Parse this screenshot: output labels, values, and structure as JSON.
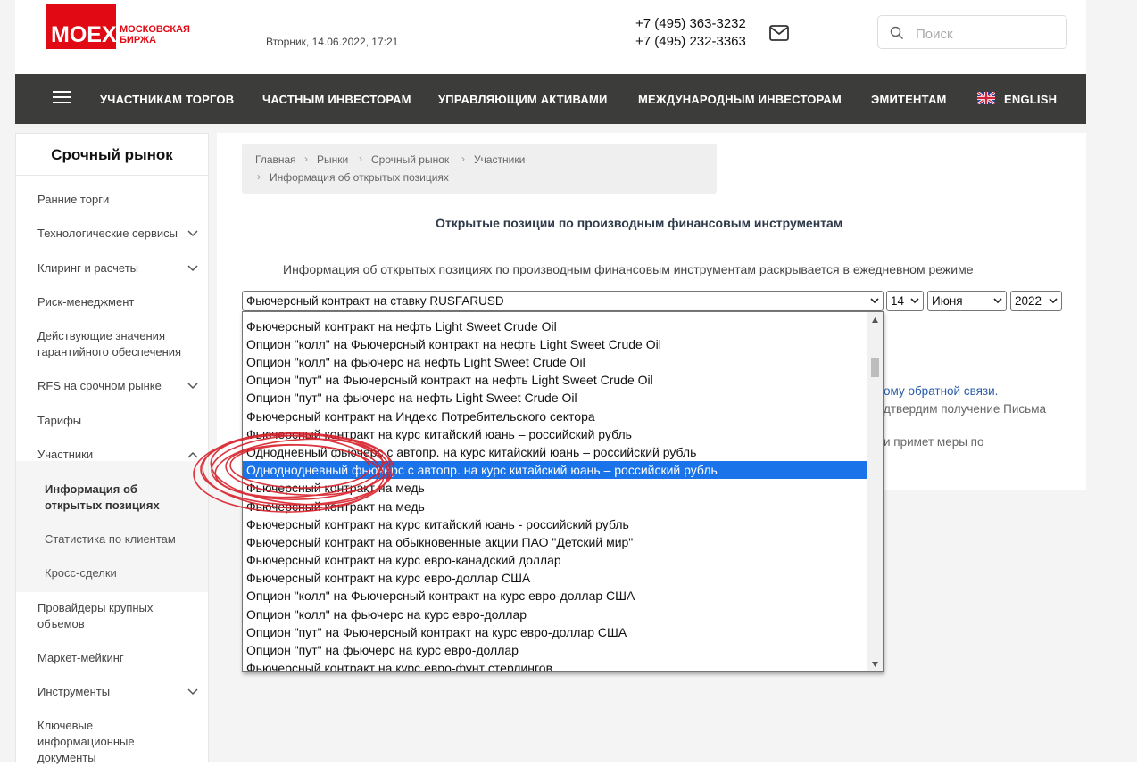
{
  "header": {
    "logo_main": "MOEX",
    "logo_sub_line1": "МОСКОВСКАЯ",
    "logo_sub_line2": "БИРЖА",
    "datetime": "Вторник, 14.06.2022, 17:21",
    "phone1": "+7 (495) 363-3232",
    "phone2": "+7 (495) 232-3363",
    "search_placeholder": "Поиск"
  },
  "nav": {
    "items": [
      "УЧАСТНИКАМ ТОРГОВ",
      "ЧАСТНЫМ ИНВЕСТОРАМ",
      "УПРАВЛЯЮЩИМ АКТИВАМИ",
      "МЕЖДУНАРОДНЫМ ИНВЕСТОРАМ",
      "ЭМИТЕНТАМ",
      "ENGLISH"
    ]
  },
  "sidebar": {
    "title": "Срочный рынок",
    "items": [
      {
        "label": "Ранние торги"
      },
      {
        "label": "Технологические сервисы"
      },
      {
        "label": "Клиринг и расчеты"
      },
      {
        "label": "Риск-менеджмент"
      },
      {
        "label_line1": "Действующие значения",
        "label_line2": "гарантийного обеспечения"
      },
      {
        "label": "RFS на срочном рынке"
      },
      {
        "label": "Тарифы"
      },
      {
        "label": "Участники"
      },
      {
        "label_line1": "Провайдеры крупных",
        "label_line2": "объемов"
      },
      {
        "label": "Маркет-мейкинг"
      },
      {
        "label": "Инструменты"
      },
      {
        "label_line1": "Ключевые",
        "label_line2": "информационные",
        "label_line3": "документы"
      }
    ],
    "subitems": [
      {
        "label_line1": "Информация об",
        "label_line2": "открытых позициях"
      },
      {
        "label": "Статистика по клиентам"
      },
      {
        "label": "Кросс-сделки"
      }
    ]
  },
  "breadcrumb": [
    "Главная",
    "Рынки",
    "Срочный рынок",
    "Участники",
    "Информация об открытых позициях"
  ],
  "page": {
    "title": "Открытые позиции по производным финансовым инструментам",
    "info": "Информация об открытых позициях по производным финансовым инструментам раскрывается в ежедневном режиме",
    "frag1": "ому обратной связи.",
    "frag2": "дтвердим получение Письма",
    "frag3": "и примет меры по"
  },
  "selects": {
    "instrument": "Фьючерсный контракт на ставку RUSFARUSD",
    "day": "14",
    "month": "Июня",
    "year": "2022"
  },
  "dropdown": {
    "options": [
      "Фьючерсный контракт на нефть Light Sweet Crude Oil",
      "Опцион \"колл\" на Фьючерсный контракт на нефть Light Sweet Crude Oil",
      "Опцион \"колл\" на фьючерс на нефть Light Sweet Crude Oil",
      "Опцион \"пут\" на Фьючерсный контракт на нефть Light Sweet Crude Oil",
      "Опцион \"пут\" на фьючерс на нефть Light Sweet Crude Oil",
      "Фьючерсный контракт на Индекс Потребительского сектора",
      "Фьючерсный контракт на курс китайский юань – российский рубль",
      "Однодневный фьючерс с автопр. на курс китайский юань – российский рубль",
      "Однодноднeвный фьючерс с автопр. на курс китайский юань – российский рубль",
      "Фьючерсный контракт на медь",
      "Фьючерсный контракт на медь",
      "Фьючерсный контракт на курс китайский юань - российский рубль",
      "Фьючерсный контракт на обыкновенные акции ПАО \"Детский мир\"",
      "Фьючерсный контракт на курс евро-канадский доллар",
      "Фьючерсный контракт на курс евро-доллар США",
      "Опцион \"колл\" на Фьючерсный контракт на курс евро-доллар США",
      "Опцион \"колл\" на фьючерс на курс евро-доллар",
      "Опцион \"пут\" на Фьючерсный контракт на курс евро-доллар США",
      "Опцион \"пут\" на фьючерс на курс евро-доллар",
      "Фьючерсный контракт на курс евро-фунт стерлингов"
    ],
    "selected_index": 8,
    "highlight_color": "#1a73e8"
  },
  "colors": {
    "brand_red": "#e10a14",
    "nav_bg": "#3c3d3a",
    "annotation": "#d8202a"
  }
}
